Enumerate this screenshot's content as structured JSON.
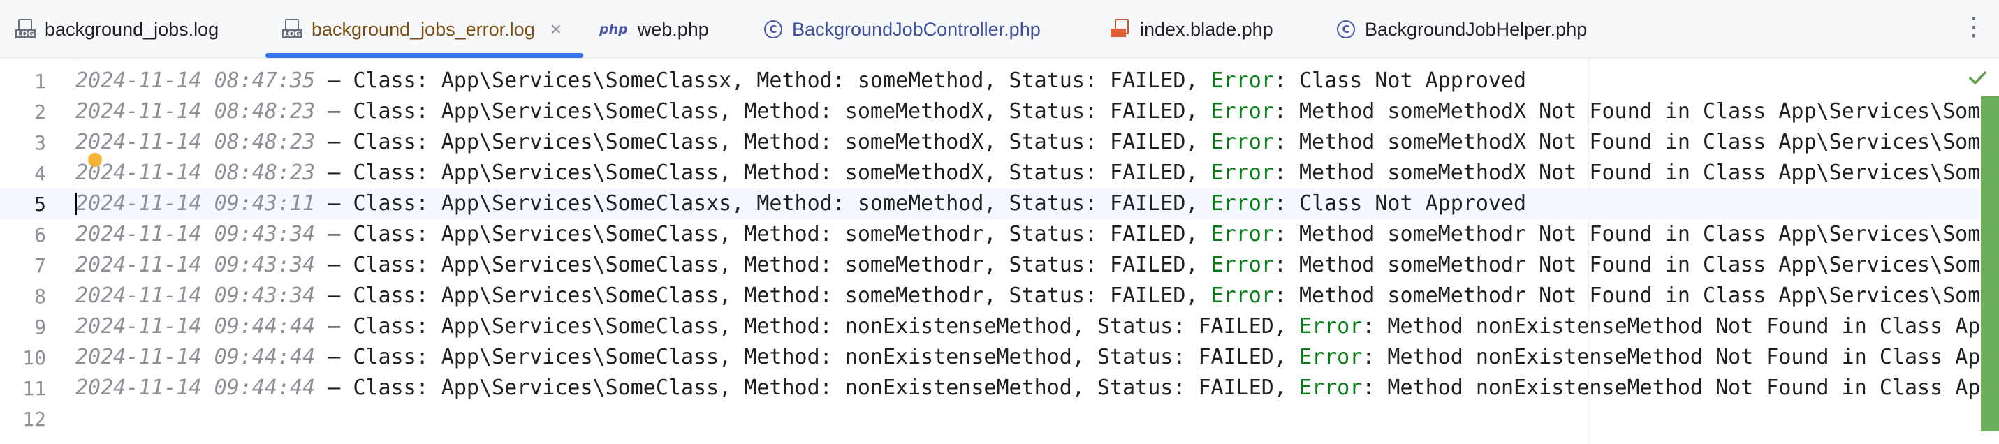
{
  "tabs": [
    {
      "label": "background_jobs.log",
      "icon": "log-file-icon",
      "active": false
    },
    {
      "label": "background_jobs_error.log",
      "icon": "log-file-icon",
      "active": true,
      "close": "×"
    },
    {
      "label": "web.php",
      "icon": "php-file-icon",
      "active": false,
      "icon_text": "php"
    },
    {
      "label": "BackgroundJobController.php",
      "icon": "class-icon",
      "active": false,
      "icon_text": "C"
    },
    {
      "label": "index.blade.php",
      "icon": "blade-html-icon",
      "active": false
    },
    {
      "label": "BackgroundJobHelper.php",
      "icon": "class-icon",
      "active": false,
      "icon_text": "C"
    }
  ],
  "colors": {
    "active_tab_text": "#7a4d0f",
    "tab_underline": "#3574f0",
    "error_keyword": "#067d17",
    "timestamp": "#8c8f96",
    "scroll_marker": "#6cae5b"
  },
  "current_line": 5,
  "lines": [
    {
      "num": "1",
      "ts": "2024-11-14 08:47:35",
      "pre": " – Class: App\\Services\\SomeClassx, Method: someMethod, Status: FAILED, ",
      "err": "Error",
      "post": ": Class Not Approved"
    },
    {
      "num": "2",
      "ts": "2024-11-14 08:48:23",
      "pre": " – Class: App\\Services\\SomeClass, Method: someMethodX, Status: FAILED, ",
      "err": "Error",
      "post": ": Method someMethodX Not Found in Class App\\Services\\Som"
    },
    {
      "num": "3",
      "ts": "2024-11-14 08:48:23",
      "pre": " – Class: App\\Services\\SomeClass, Method: someMethodX, Status: FAILED, ",
      "err": "Error",
      "post": ": Method someMethodX Not Found in Class App\\Services\\Som"
    },
    {
      "num": "4",
      "ts": "2024-11-14 08:48:23",
      "pre": " – Class: App\\Services\\SomeClass, Method: someMethodX, Status: FAILED, ",
      "err": "Error",
      "post": ": Method someMethodX Not Found in Class App\\Services\\Som"
    },
    {
      "num": "5",
      "ts": "2024-11-14 09:43:11",
      "pre": " – Class: App\\Services\\SomeClasxs, Method: someMethod, Status: FAILED, ",
      "err": "Error",
      "post": ": Class Not Approved"
    },
    {
      "num": "6",
      "ts": "2024-11-14 09:43:34",
      "pre": " – Class: App\\Services\\SomeClass, Method: someMethodr, Status: FAILED, ",
      "err": "Error",
      "post": ": Method someMethodr Not Found in Class App\\Services\\Som"
    },
    {
      "num": "7",
      "ts": "2024-11-14 09:43:34",
      "pre": " – Class: App\\Services\\SomeClass, Method: someMethodr, Status: FAILED, ",
      "err": "Error",
      "post": ": Method someMethodr Not Found in Class App\\Services\\Som"
    },
    {
      "num": "8",
      "ts": "2024-11-14 09:43:34",
      "pre": " – Class: App\\Services\\SomeClass, Method: someMethodr, Status: FAILED, ",
      "err": "Error",
      "post": ": Method someMethodr Not Found in Class App\\Services\\Som"
    },
    {
      "num": "9",
      "ts": "2024-11-14 09:44:44",
      "pre": " – Class: App\\Services\\SomeClass, Method: nonExistenseMethod, Status: FAILED, ",
      "err": "Error",
      "post": ": Method nonExistenseMethod Not Found in Class Ap"
    },
    {
      "num": "10",
      "ts": "2024-11-14 09:44:44",
      "pre": " – Class: App\\Services\\SomeClass, Method: nonExistenseMethod, Status: FAILED, ",
      "err": "Error",
      "post": ": Method nonExistenseMethod Not Found in Class Ap"
    },
    {
      "num": "11",
      "ts": "2024-11-14 09:44:44",
      "pre": " – Class: App\\Services\\SomeClass, Method: nonExistenseMethod, Status: FAILED, ",
      "err": "Error",
      "post": ": Method nonExistenseMethod Not Found in Class Ap"
    },
    {
      "num": "12",
      "ts": "",
      "pre": "",
      "err": "",
      "post": ""
    }
  ]
}
